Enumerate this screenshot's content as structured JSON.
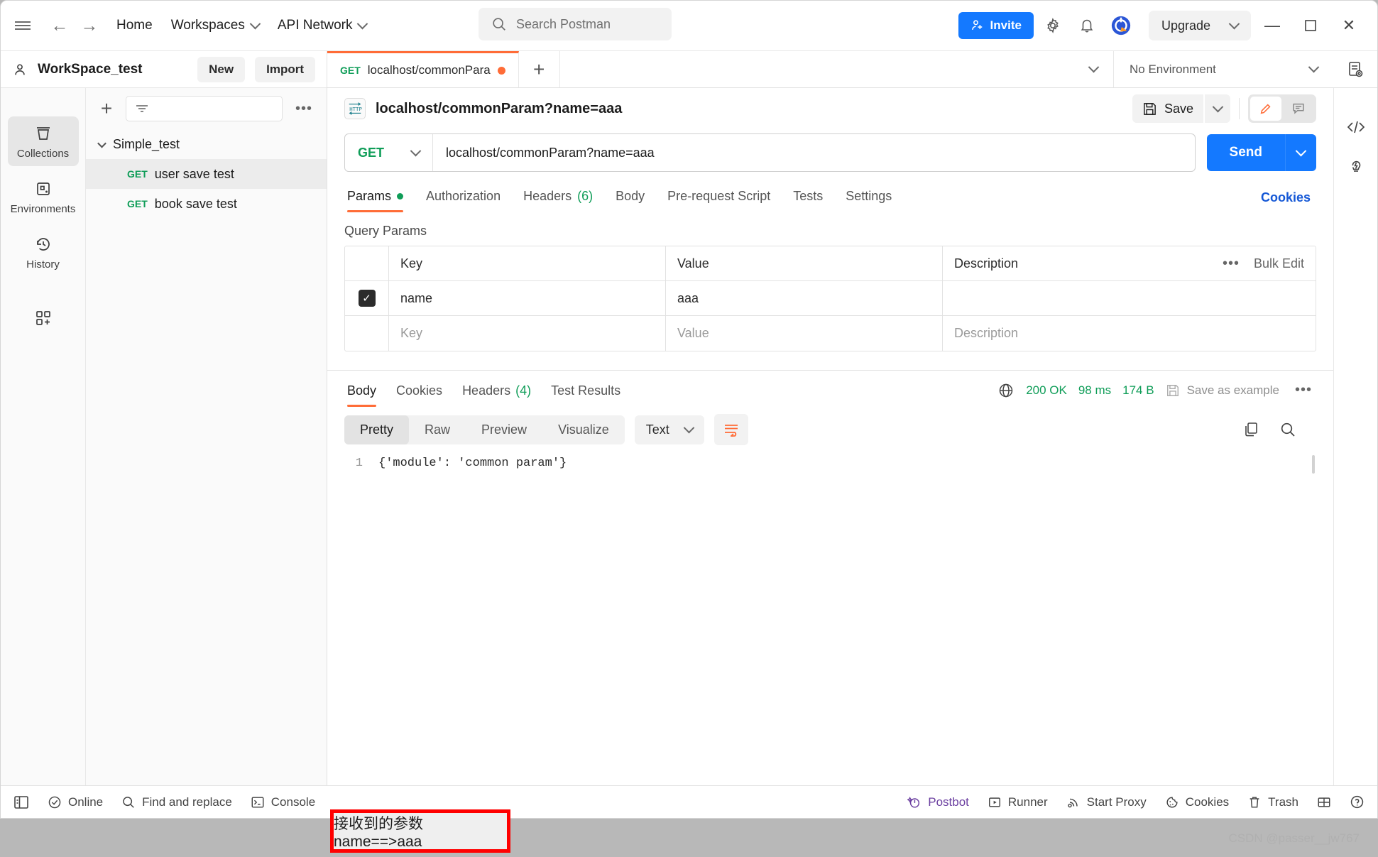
{
  "header": {
    "nav": [
      {
        "label": "Home",
        "caret": false
      },
      {
        "label": "Workspaces",
        "caret": true
      },
      {
        "label": "API Network",
        "caret": true
      }
    ],
    "search_placeholder": "Search Postman",
    "invite_label": "Invite",
    "upgrade_label": "Upgrade",
    "icons": {
      "hamburger": "hamburger-icon",
      "back": "back-arrow-icon",
      "forward": "forward-arrow-icon",
      "search": "search-icon",
      "settings": "gear-icon",
      "notifications": "bell-icon",
      "account": "account-avatar-icon",
      "minimize": "minimize-icon",
      "maximize": "maximize-icon",
      "close": "close-icon"
    }
  },
  "sidebar": {
    "workspace_name": "WorkSpace_test",
    "new_label": "New",
    "import_label": "Import",
    "filter_placeholder": "",
    "rail": [
      {
        "label": "Collections",
        "icon": "collections-icon",
        "active": true
      },
      {
        "label": "Environments",
        "icon": "environments-icon",
        "active": false
      },
      {
        "label": "History",
        "icon": "history-icon",
        "active": false
      },
      {
        "label": "",
        "icon": "apps-grid-icon",
        "active": false
      }
    ],
    "collection": {
      "name": "Simple_test",
      "requests": [
        {
          "method": "GET",
          "name": "user save test",
          "selected": true
        },
        {
          "method": "GET",
          "name": "book save test",
          "selected": false
        }
      ]
    }
  },
  "tabs": {
    "open": [
      {
        "method": "GET",
        "title": "localhost/commonPara",
        "unsaved": true,
        "active": true
      }
    ],
    "new_tab_icon": "plus-icon",
    "environment_selected": "No Environment"
  },
  "request": {
    "protocol_badge": "HTTP",
    "title": "localhost/commonParam?name=aaa",
    "save_label": "Save",
    "method": "GET",
    "url": "localhost/commonParam?name=aaa",
    "send_label": "Send",
    "sub_tabs": [
      {
        "label": "Params",
        "dot": true,
        "count": "",
        "active": true
      },
      {
        "label": "Authorization",
        "dot": false,
        "count": "",
        "active": false
      },
      {
        "label": "Headers",
        "dot": false,
        "count": "(6)",
        "active": false
      },
      {
        "label": "Body",
        "dot": false,
        "count": "",
        "active": false
      },
      {
        "label": "Pre-request Script",
        "dot": false,
        "count": "",
        "active": false
      },
      {
        "label": "Tests",
        "dot": false,
        "count": "",
        "active": false
      },
      {
        "label": "Settings",
        "dot": false,
        "count": "",
        "active": false
      }
    ],
    "cookies_link": "Cookies",
    "query_params_label": "Query Params",
    "table": {
      "headers": {
        "key": "Key",
        "value": "Value",
        "description": "Description"
      },
      "bulk_edit_label": "Bulk Edit",
      "rows": [
        {
          "checked": true,
          "key": "name",
          "value": "aaa",
          "description": ""
        }
      ],
      "placeholder_row": {
        "key": "Key",
        "value": "Value",
        "description": "Description"
      }
    }
  },
  "response": {
    "tabs": [
      {
        "label": "Body",
        "count": "",
        "active": true
      },
      {
        "label": "Cookies",
        "count": "",
        "active": false
      },
      {
        "label": "Headers",
        "count": "(4)",
        "active": false
      },
      {
        "label": "Test Results",
        "count": "",
        "active": false
      }
    ],
    "status": "200 OK",
    "time": "98 ms",
    "size": "174 B",
    "save_as_example": "Save as example",
    "format_tabs": [
      {
        "label": "Pretty",
        "active": true
      },
      {
        "label": "Raw",
        "active": false
      },
      {
        "label": "Preview",
        "active": false
      },
      {
        "label": "Visualize",
        "active": false
      }
    ],
    "content_type": "Text",
    "body_lines": [
      {
        "number": "1",
        "text": "{'module': 'common param'}"
      }
    ]
  },
  "statusbar": {
    "left": [
      {
        "label": "Online",
        "icon": "check-circle-icon"
      },
      {
        "label": "Find and replace",
        "icon": "search-icon"
      },
      {
        "label": "Console",
        "icon": "terminal-icon"
      }
    ],
    "sidebar_toggle_icon": "sidebar-toggle-icon",
    "right": [
      {
        "label": "Postbot",
        "icon": "postbot-icon"
      },
      {
        "label": "Runner",
        "icon": "runner-icon"
      },
      {
        "label": "Start Proxy",
        "icon": "proxy-icon"
      },
      {
        "label": "Cookies",
        "icon": "cookie-icon"
      },
      {
        "label": "Trash",
        "icon": "trash-icon"
      }
    ],
    "layout_icon": "layout-icon",
    "help_icon": "help-icon"
  },
  "annotation": {
    "text": "接收到的参数name==>aaa"
  },
  "watermark": "CSDN @passer__jw767",
  "colors": {
    "accent": "#ff6c37",
    "primary": "#1479ff",
    "success": "#0f9d58",
    "link": "#1558d6",
    "annotation_border": "#ff0000"
  }
}
